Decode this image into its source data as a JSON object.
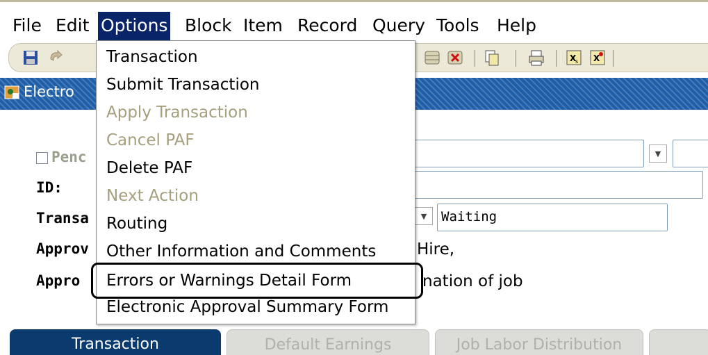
{
  "menubar": {
    "items": [
      "File",
      "Edit",
      "Options",
      "Block",
      "Item",
      "Record",
      "Query",
      "Tools",
      "Help"
    ],
    "active": "Options"
  },
  "toolbar": {
    "buttons": [
      "save-icon",
      "rollback-icon",
      "database-icon",
      "delete-record-icon",
      "copy-icon",
      "print-icon",
      "exit-icon",
      "exit-quit-icon"
    ]
  },
  "window": {
    "title": "Electro"
  },
  "form": {
    "pending_label": "Penc",
    "id_label": "ID:",
    "transaction_label": "Transa",
    "approval_label_1": "Approv",
    "approval_label_2": "Appro",
    "status_value": "Waiting",
    "approval_text_1": "Hire,",
    "approval_text_2": "nation of job"
  },
  "options_menu": {
    "items": [
      {
        "label": "Transaction",
        "enabled": true
      },
      {
        "label": "Submit Transaction",
        "enabled": true
      },
      {
        "label": "Apply Transaction",
        "enabled": false
      },
      {
        "label": "Cancel PAF",
        "enabled": false
      },
      {
        "label": "Delete PAF",
        "enabled": true
      },
      {
        "label": "Next Action",
        "enabled": false
      },
      {
        "label": "Routing",
        "enabled": true
      },
      {
        "label": "Other Information and Comments",
        "enabled": true
      },
      {
        "label": "Errors or Warnings Detail Form",
        "enabled": true
      },
      {
        "label": "Electronic Approval Summary Form",
        "enabled": true
      }
    ],
    "highlighted": "Errors or Warnings Detail Form"
  },
  "tabs": [
    {
      "label": "Transaction",
      "active": true
    },
    {
      "label": "Default Earnings",
      "active": false
    },
    {
      "label": "Job Labor Distribution",
      "active": false
    }
  ],
  "colors": {
    "menu_active_bg": "#0a246a",
    "title_bar": "#1e5ea8",
    "disabled_text": "#a59f7e",
    "tab_active": "#0a3a6e"
  }
}
